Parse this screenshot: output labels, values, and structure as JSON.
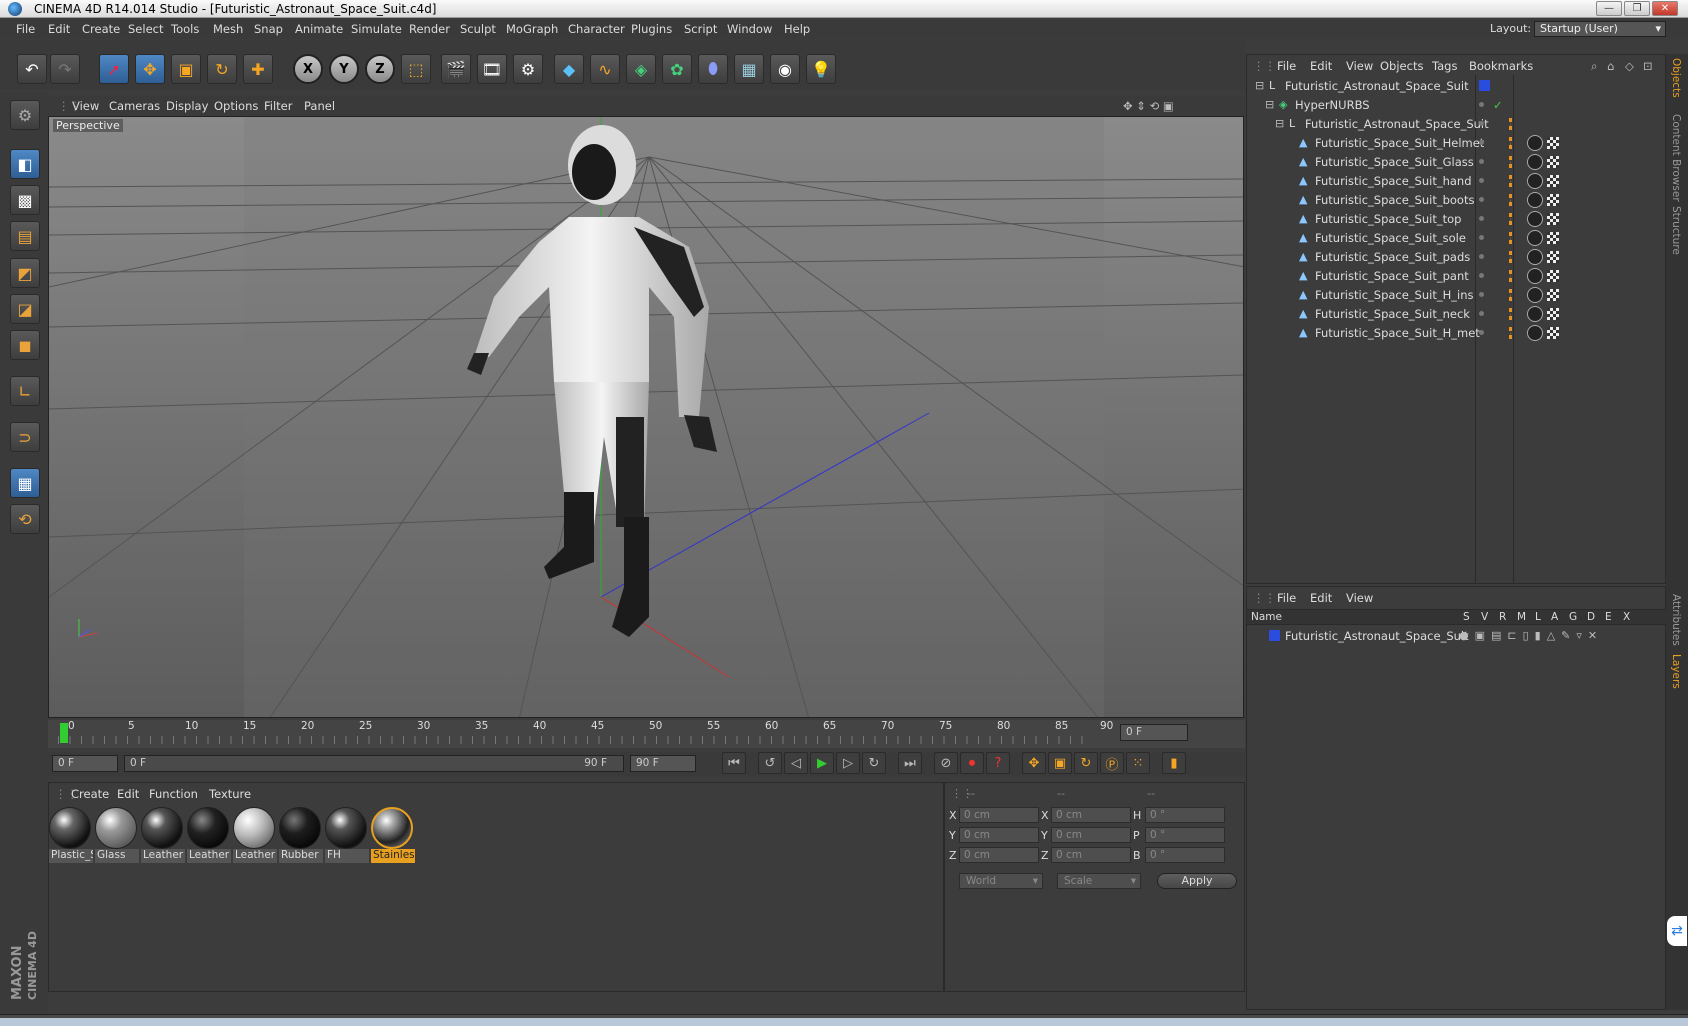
{
  "window": {
    "title": "CINEMA 4D R14.014 Studio - [Futuristic_Astronaut_Space_Suit.c4d]",
    "min": "—",
    "restore": "❐",
    "close": "✕"
  },
  "menu": [
    "File",
    "Edit",
    "Create",
    "Select",
    "Tools",
    "Mesh",
    "Snap",
    "Animate",
    "Simulate",
    "Render",
    "Sculpt",
    "MoGraph",
    "Character",
    "Plugins",
    "Script",
    "Window",
    "Help"
  ],
  "layout": {
    "label": "Layout:",
    "value": "Startup (User)"
  },
  "toolbar": {
    "axis_x": "X",
    "axis_y": "Y",
    "axis_z": "Z"
  },
  "viewport": {
    "menu": [
      "View",
      "Cameras",
      "Display",
      "Options",
      "Filter",
      "Panel"
    ],
    "label": "Perspective"
  },
  "timeline": {
    "ticks": [
      "0",
      "5",
      "10",
      "15",
      "20",
      "25",
      "30",
      "35",
      "40",
      "45",
      "50",
      "55",
      "60",
      "65",
      "70",
      "75",
      "80",
      "85",
      "90"
    ],
    "current": "0 F",
    "start": "0 F",
    "range_start": "0 F",
    "range_end": "90 F",
    "end": "90 F"
  },
  "materials": {
    "menu": [
      "Create",
      "Edit",
      "Function",
      "Texture"
    ],
    "items": [
      {
        "label": "Plastic_S",
        "style": "dark-gloss"
      },
      {
        "label": "Glass",
        "style": "glass"
      },
      {
        "label": "Leather",
        "style": "dark-gloss"
      },
      {
        "label": "Leather",
        "style": "black"
      },
      {
        "label": "Leather",
        "style": "light"
      },
      {
        "label": "Rubber",
        "style": "black"
      },
      {
        "label": "FH",
        "style": "dark-gloss"
      },
      {
        "label": "Stainles",
        "style": "metal",
        "selected": true
      }
    ]
  },
  "coords": {
    "headers": [
      "--",
      "--",
      "--"
    ],
    "rows": [
      {
        "a": "X",
        "av": "0 cm",
        "b": "X",
        "bv": "0 cm",
        "c": "H",
        "cv": "0 °"
      },
      {
        "a": "Y",
        "av": "0 cm",
        "b": "Y",
        "bv": "0 cm",
        "c": "P",
        "cv": "0 °"
      },
      {
        "a": "Z",
        "av": "0 cm",
        "b": "Z",
        "bv": "0 cm",
        "c": "B",
        "cv": "0 °"
      }
    ],
    "mode1": "World",
    "mode2": "Scale",
    "apply": "Apply"
  },
  "objects": {
    "menu": [
      "File",
      "Edit",
      "View",
      "Objects",
      "Tags",
      "Bookmarks"
    ],
    "tree": [
      {
        "name": "Futuristic_Astronaut_Space_Suit",
        "indent": 0,
        "icon": "null",
        "level": "root"
      },
      {
        "name": "HyperNURBS",
        "indent": 1,
        "icon": "nurbs",
        "check": "✓"
      },
      {
        "name": "Futuristic_Astronaut_Space_Suit",
        "indent": 2,
        "icon": "null"
      },
      {
        "name": "Futuristic_Space_Suit_Helmet",
        "indent": 3,
        "icon": "mesh"
      },
      {
        "name": "Futuristic_Space_Suit_Glass",
        "indent": 3,
        "icon": "mesh"
      },
      {
        "name": "Futuristic_Space_Suit_hand",
        "indent": 3,
        "icon": "mesh"
      },
      {
        "name": "Futuristic_Space_Suit_boots",
        "indent": 3,
        "icon": "mesh"
      },
      {
        "name": "Futuristic_Space_Suit_top",
        "indent": 3,
        "icon": "mesh"
      },
      {
        "name": "Futuristic_Space_Suit_sole",
        "indent": 3,
        "icon": "mesh"
      },
      {
        "name": "Futuristic_Space_Suit_pads",
        "indent": 3,
        "icon": "mesh"
      },
      {
        "name": "Futuristic_Space_Suit_pant",
        "indent": 3,
        "icon": "mesh"
      },
      {
        "name": "Futuristic_Space_Suit_H_ins",
        "indent": 3,
        "icon": "mesh"
      },
      {
        "name": "Futuristic_Space_Suit_neck",
        "indent": 3,
        "icon": "mesh"
      },
      {
        "name": "Futuristic_Space_Suit_H_met",
        "indent": 3,
        "icon": "mesh"
      }
    ]
  },
  "layers": {
    "menu": [
      "File",
      "Edit",
      "View"
    ],
    "columns": [
      "Name",
      "S",
      "V",
      "R",
      "M",
      "L",
      "A",
      "G",
      "D",
      "E",
      "X"
    ],
    "rows": [
      {
        "name": "Futuristic_Astronaut_Space_Suit",
        "color": "#2a4de0"
      }
    ]
  },
  "side_tabs": [
    "Objects",
    "Content Browser",
    "Structure",
    "Attributes",
    "Layers"
  ],
  "brand": {
    "maxon": "MAXON",
    "product": "CINEMA 4D"
  }
}
